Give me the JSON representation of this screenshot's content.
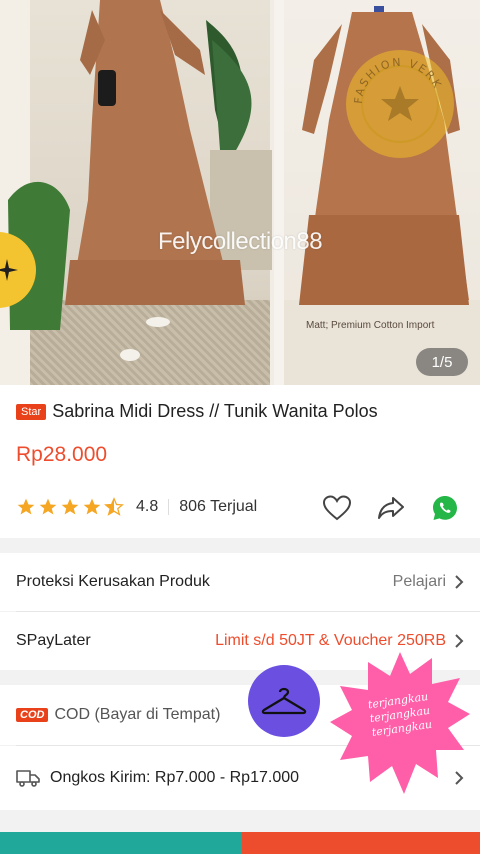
{
  "gallery": {
    "watermark": "Felycollection88",
    "caption": "Matt; Premium Cotton Import",
    "page_indicator": "1/5",
    "seal_text": "FASHION VERK"
  },
  "product": {
    "tag": "Star",
    "title": "Sabrina Midi Dress // Tunik Wanita Polos",
    "price": "Rp28.000",
    "rating": "4.8",
    "rating_stars": 4.5,
    "sold": "806 Terjual"
  },
  "rows": {
    "protection": {
      "label": "Proteksi Kerusakan Produk",
      "action": "Pelajari"
    },
    "paylater": {
      "label": "SPayLater",
      "action": "Limit s/d 50JT & Voucher 250RB"
    },
    "cod": {
      "tag": "COD",
      "label": "COD (Bayar di Tempat)"
    },
    "shipping": {
      "label": "Ongkos Kirim: Rp7.000 - Rp17.000"
    }
  },
  "sticker": {
    "lines": [
      "terjangkau",
      "terjangkau",
      "terjangkau"
    ]
  },
  "colors": {
    "accent": "#ee4d2d",
    "star": "#f5a623",
    "whatsapp": "#25b648",
    "sticker_pink": "#ff5ea8",
    "hanger_bg": "#6a4fe0"
  }
}
